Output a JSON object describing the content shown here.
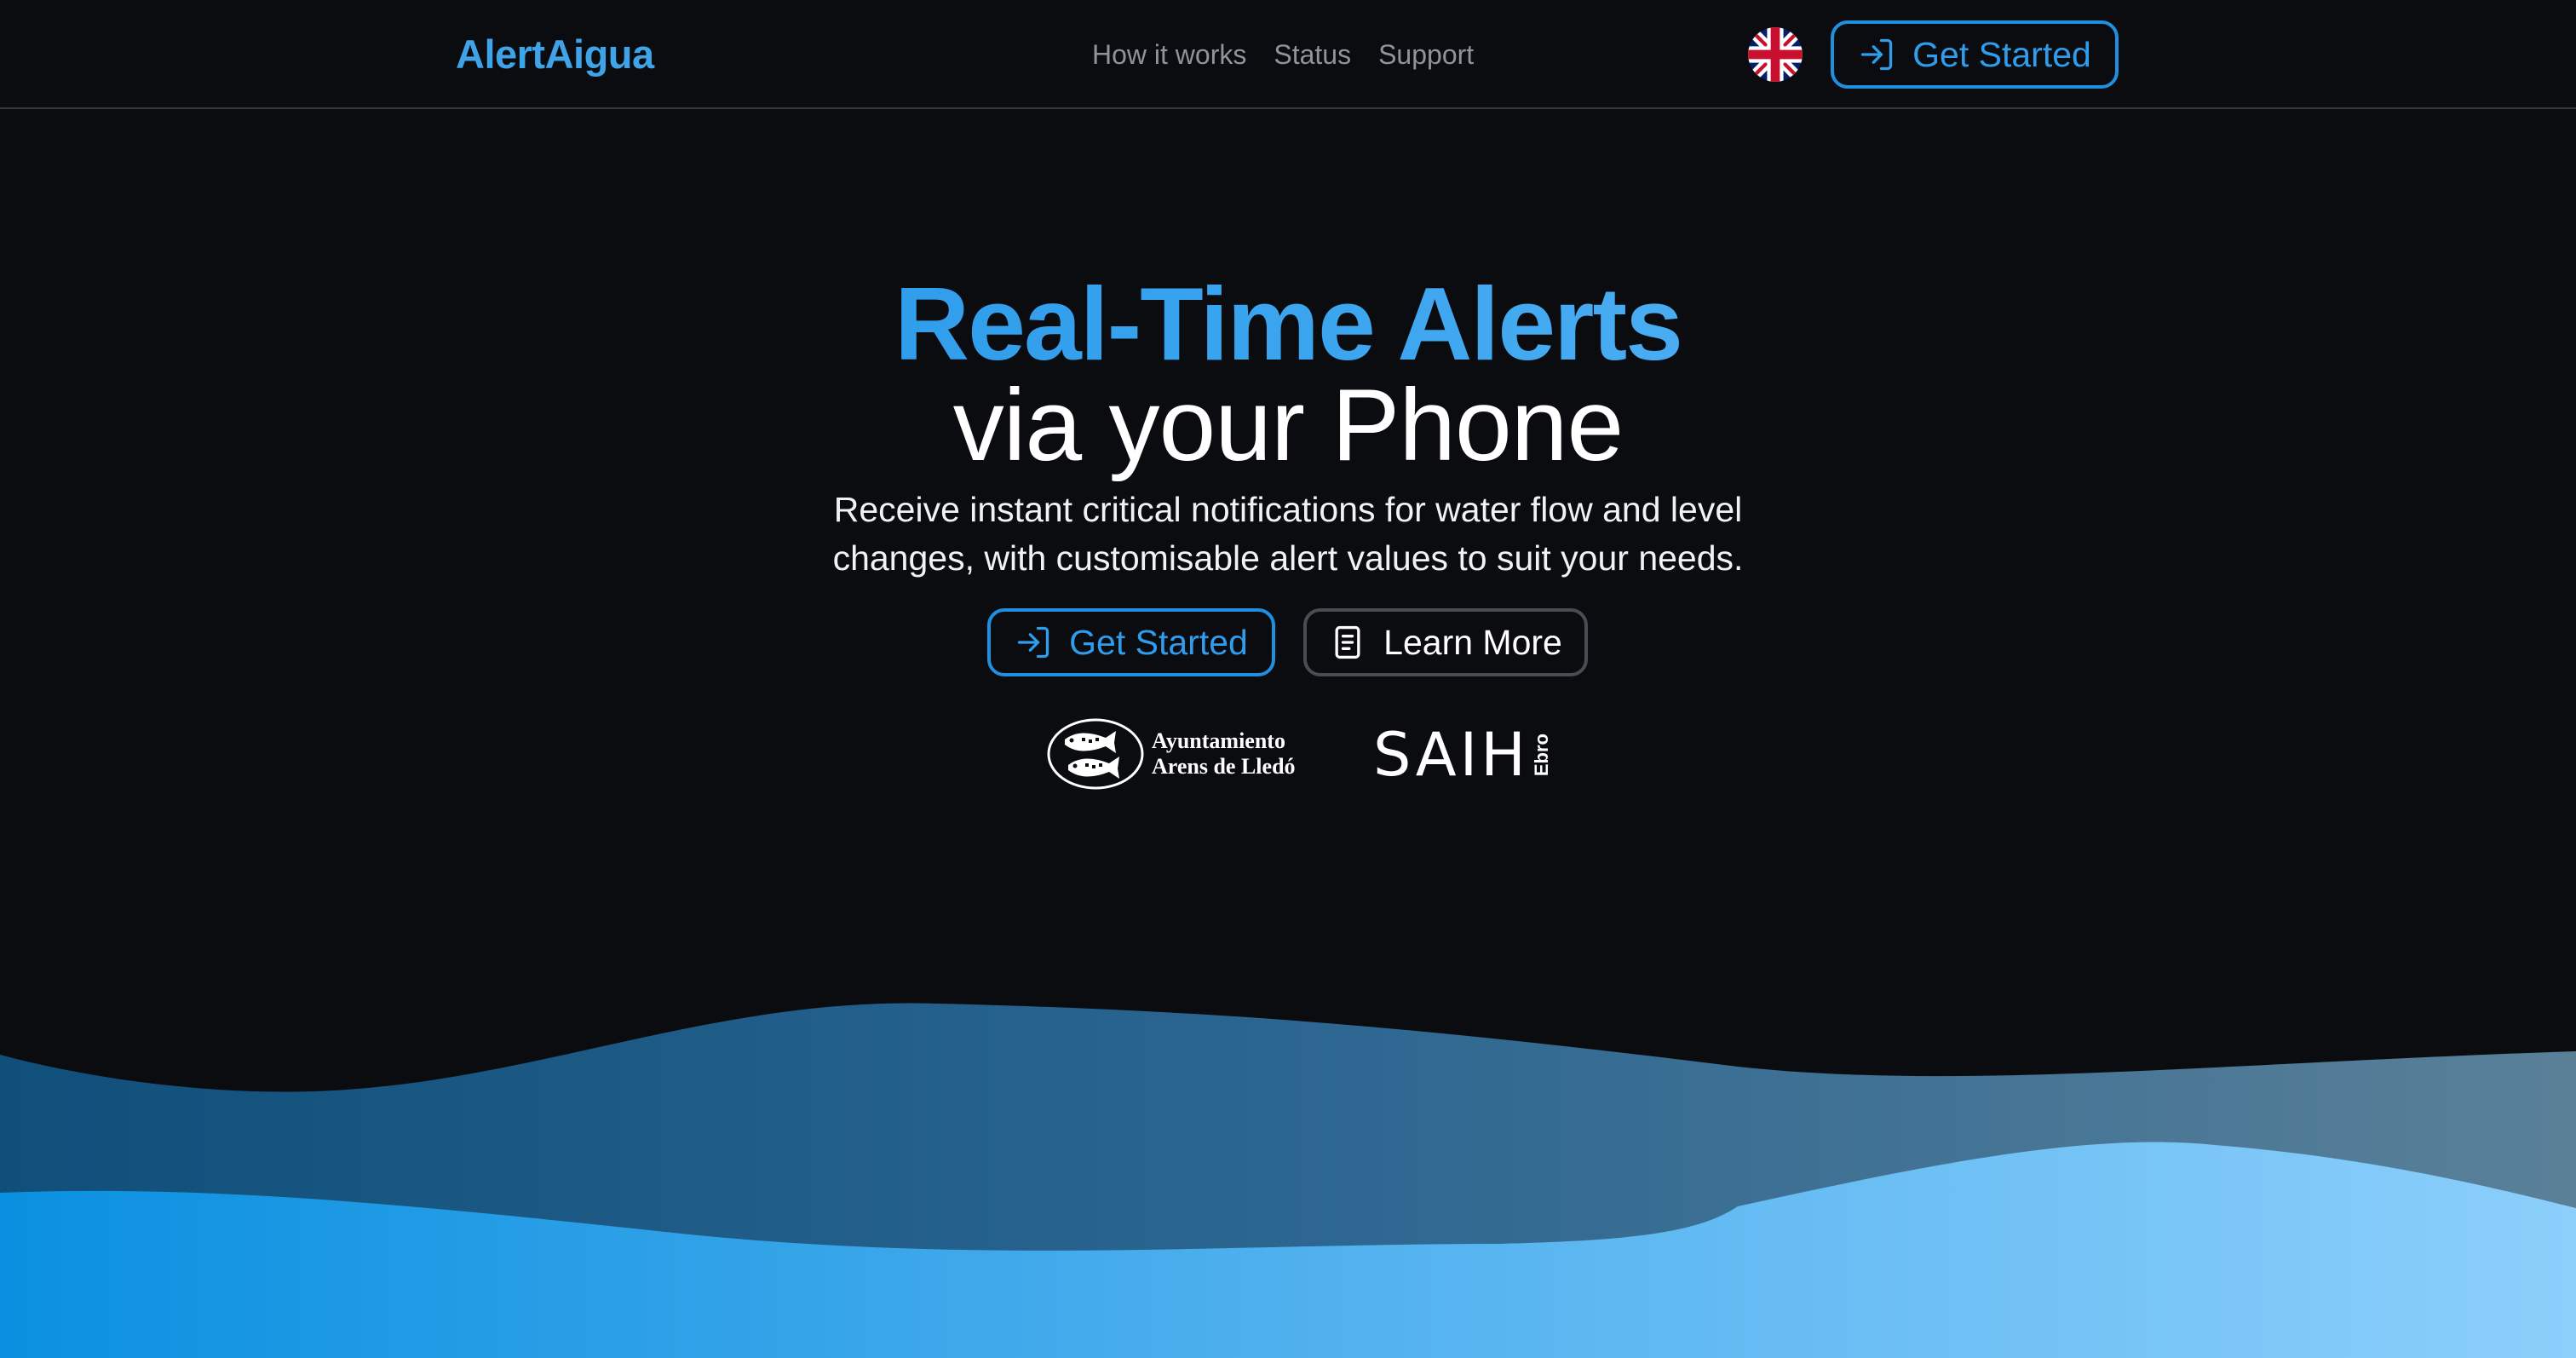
{
  "nav": {
    "brand": "AlertAigua",
    "links": [
      "How it works",
      "Status",
      "Support"
    ],
    "language_flag": "uk-flag-icon",
    "cta_label": "Get Started"
  },
  "hero": {
    "title_line1": "Real-Time Alerts",
    "title_line2": "via your Phone",
    "subtitle_line1": "Receive instant critical notifications for water flow and level",
    "subtitle_line2": "changes, with customisable alert values to suit your needs.",
    "cta_primary": "Get Started",
    "cta_secondary": "Learn More"
  },
  "partners": {
    "ayuntamiento_line1": "Ayuntamiento",
    "ayuntamiento_line2": "Arens de Lledó",
    "saih_main": "SAIH",
    "saih_sub": "Ebro"
  },
  "colors": {
    "background": "#0b0c10",
    "accent": "#2f9cec",
    "muted_link": "#8e939c"
  }
}
